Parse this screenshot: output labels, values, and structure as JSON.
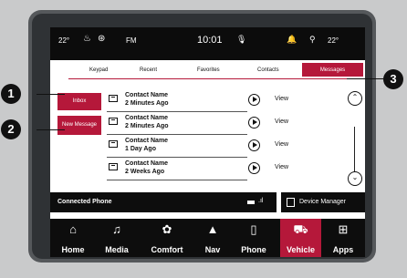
{
  "status": {
    "temp_left": "22°",
    "radio": "FM",
    "time": "10:01",
    "temp_right": "22°"
  },
  "tabs": {
    "keypad": "Keypad",
    "recent": "Recent",
    "favorites": "Favorites",
    "contacts": "Contacts",
    "messages": "Messages"
  },
  "side": {
    "inbox": "Inbox",
    "new_message": "New Message"
  },
  "messages": [
    {
      "name": "Contact Name",
      "time": "2 Minutes Ago",
      "view": "View"
    },
    {
      "name": "Contact Name",
      "time": "2 Minutes Ago",
      "view": "View"
    },
    {
      "name": "Contact Name",
      "time": "1 Day Ago",
      "view": "View"
    },
    {
      "name": "Contact Name",
      "time": "2 Weeks Ago",
      "view": "View"
    }
  ],
  "connected_phone": "Connected Phone",
  "device_manager": "Device Manager",
  "nav": [
    "Home",
    "Media",
    "Comfort",
    "Nav",
    "Phone",
    "Vehicle",
    "Apps"
  ],
  "callouts": [
    "1",
    "2",
    "3"
  ],
  "colors": {
    "accent": "#b5183a",
    "bar": "#0d0d0d"
  }
}
